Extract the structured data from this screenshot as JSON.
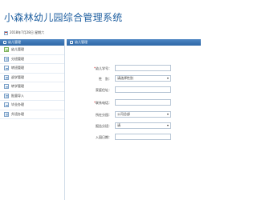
{
  "header": {
    "title": "小森林幼儿园综合管理系统",
    "date": "2018年7月28日 星期六"
  },
  "sidebar": {
    "heading": "幼儿管理",
    "items": [
      {
        "label": "幼儿管理",
        "active": true
      },
      {
        "label": "分班管理"
      },
      {
        "label": "转班管理"
      },
      {
        "label": "退学管理"
      },
      {
        "label": "转学管理"
      },
      {
        "label": "批量导入"
      },
      {
        "label": "毕业办理"
      },
      {
        "label": "升班办理"
      }
    ]
  },
  "main": {
    "heading": "幼儿管理",
    "form": {
      "student_no_label": "幼儿学号：",
      "student_no_value": "",
      "gender_label": "性　别：",
      "gender_value": "请选择性别",
      "family_address_label": "家庭住址：",
      "family_address_value": "",
      "contact_phone_label": "联系电话：",
      "contact_phone_value": "",
      "campus_label": "所在分园：",
      "campus_value": "公司总部",
      "class_label": "报告分班：",
      "class_value": "请",
      "enroll_date_label": "入园日期：",
      "enroll_date_value": ""
    }
  }
}
